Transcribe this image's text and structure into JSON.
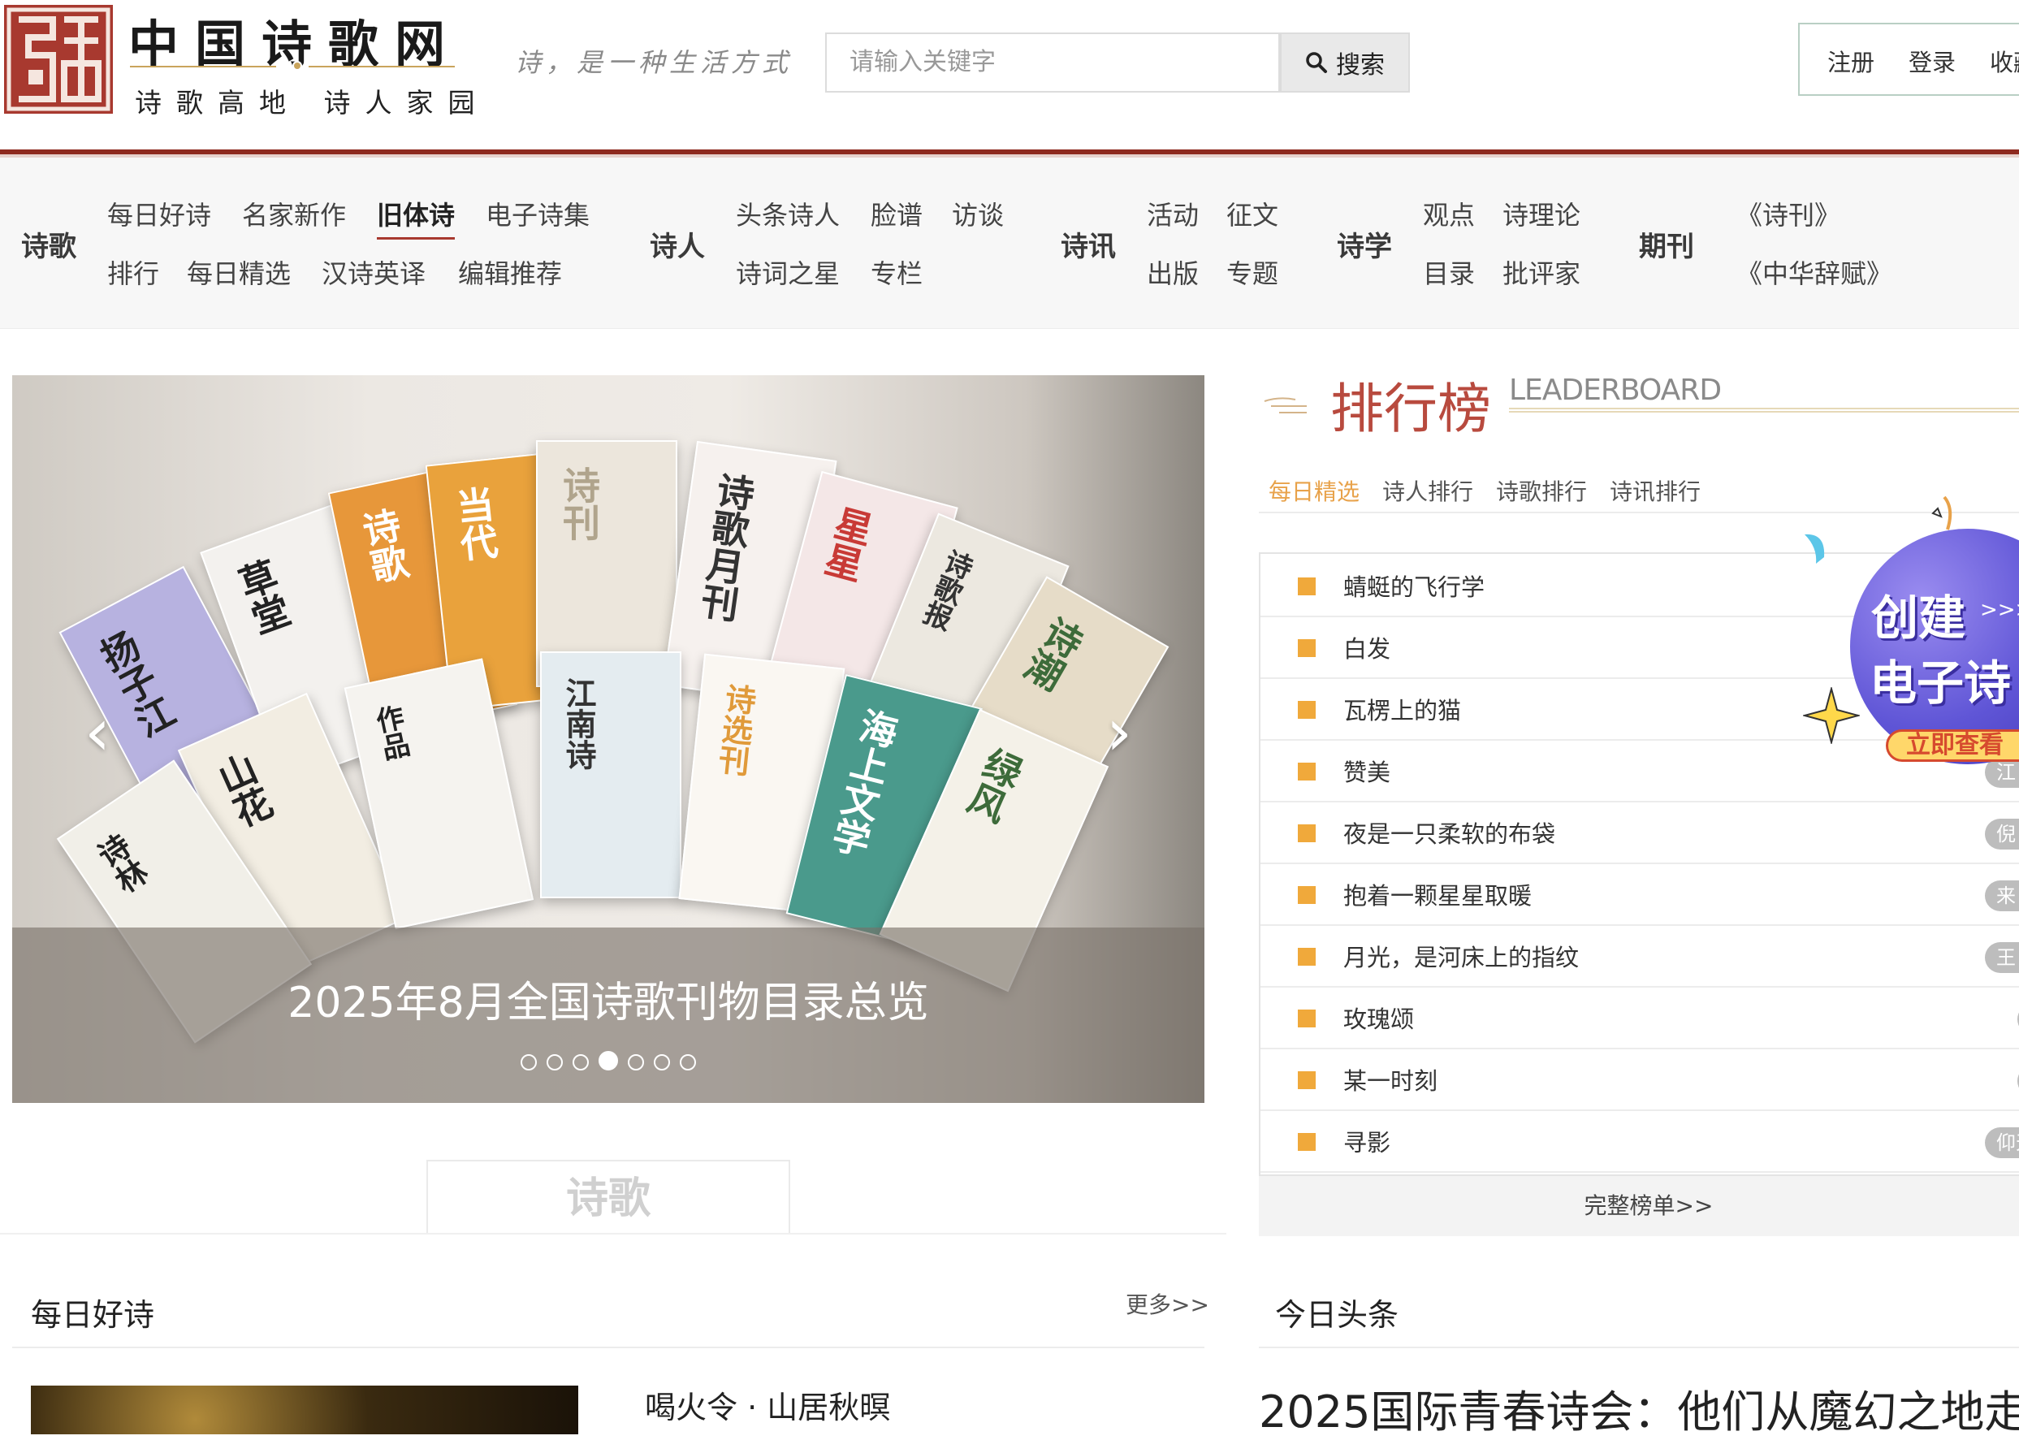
{
  "header": {
    "logo_title": "中国诗歌网",
    "logo_subtitle": "诗歌高地 诗人家园",
    "slogan": "诗，是一种生活方式",
    "search": {
      "placeholder": "请输入关键字",
      "button_label": "搜索"
    },
    "account_links": [
      "注册",
      "登录",
      "收藏"
    ]
  },
  "nav": {
    "groups": [
      {
        "category": "诗歌",
        "row1": [
          "每日好诗",
          "名家新作",
          "旧体诗",
          "电子诗集"
        ],
        "row2": [
          "排行",
          "每日精选",
          "汉诗英译",
          "编辑推荐"
        ]
      },
      {
        "category": "诗人",
        "row1": [
          "头条诗人",
          "脸谱",
          "访谈"
        ],
        "row2": [
          "诗词之星",
          "专栏"
        ]
      },
      {
        "category": "诗讯",
        "row1": [
          "活动",
          "征文"
        ],
        "row2": [
          "出版",
          "专题"
        ]
      },
      {
        "category": "诗学",
        "row1": [
          "观点",
          "诗理论"
        ],
        "row2": [
          "目录",
          "批评家"
        ]
      },
      {
        "category": "期刊",
        "row1": [
          "《诗刊》"
        ],
        "row2": [
          "《中华辞赋》"
        ]
      }
    ],
    "active_item": "旧体诗"
  },
  "carousel": {
    "caption": "2025年8月全国诗歌刊物目录总览",
    "slide_count": 7,
    "active_index": 3,
    "magazine_titles": [
      "扬子江",
      "草堂",
      "诗歌",
      "当代",
      "诗刊",
      "诗歌月刊",
      "星星",
      "诗歌报",
      "诗潮",
      "山花",
      "作品",
      "江南诗",
      "诗选刊",
      "海上文学",
      "绿风",
      "诗林"
    ]
  },
  "poetry_tab": {
    "label": "诗歌"
  },
  "daily": {
    "title": "每日好诗",
    "more_label": "更多>>",
    "first_poem": "喝火令 · 山居秋暝"
  },
  "leaderboard": {
    "title": "排行榜",
    "title_en": "LEADERBOARD",
    "tabs": [
      "每日精选",
      "诗人排行",
      "诗歌排行",
      "诗讯排行"
    ],
    "active_tab": 0,
    "items": [
      {
        "name": "蜻蜓的飞行学",
        "author": ""
      },
      {
        "name": "白发",
        "author": ""
      },
      {
        "name": "瓦楞上的猫",
        "author": ""
      },
      {
        "name": "赞美",
        "author": "江"
      },
      {
        "name": "夜是一只柔软的布袋",
        "author": "倪"
      },
      {
        "name": "抱着一颗星星取暖",
        "author": "来"
      },
      {
        "name": "月光，是河床上的指纹",
        "author": "王"
      },
      {
        "name": "玫瑰颂",
        "author": ""
      },
      {
        "name": "某一时刻",
        "author": ""
      },
      {
        "name": "寻影",
        "author": "仰天"
      }
    ],
    "footer_label": "完整榜单>>"
  },
  "ad": {
    "line1": "创建",
    "arrows": ">>>>",
    "line2": "电子诗",
    "cta": "立即查看",
    "colors": {
      "circle": "#5f55d6",
      "cta_bg": "#ffd76a",
      "cta_border": "#d64a2e"
    }
  },
  "headlines": {
    "title": "今日头条",
    "top_headline": "2025国际青春诗会：他们从魔幻之地走"
  },
  "colors": {
    "brand_red": "#8e2a1f",
    "logo_red": "#a8392f",
    "accent_orange": "#f0a93b",
    "leaderboard_red": "#b84a3e"
  }
}
